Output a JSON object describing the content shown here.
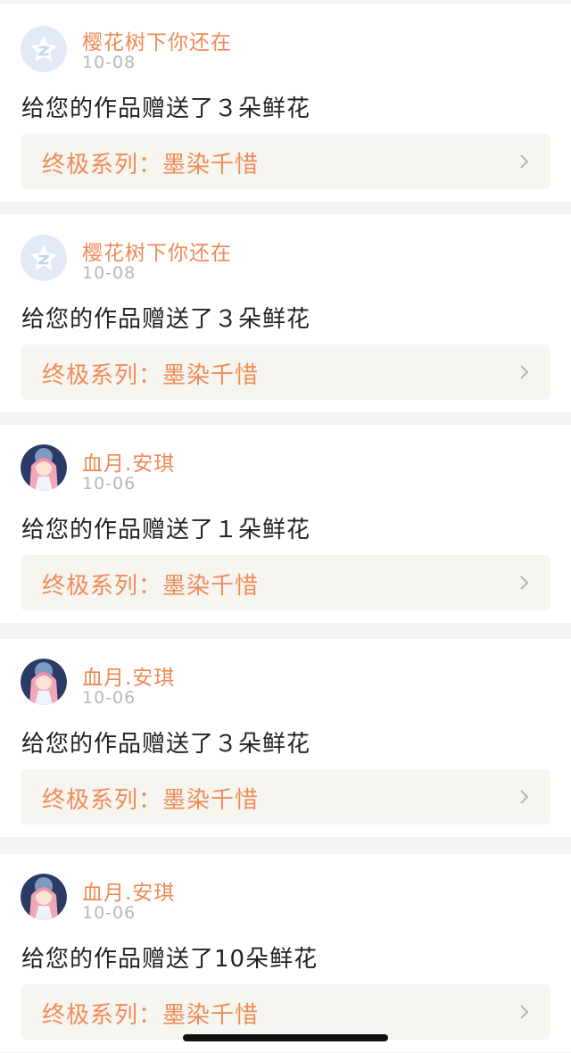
{
  "notifications": [
    {
      "user": "樱花树下你还在",
      "date": "10-08",
      "message": "给您的作品赠送了３朵鲜花",
      "work": "终极系列：墨染千惜",
      "avatar": "default-zone-avatar-icon"
    },
    {
      "user": "樱花树下你还在",
      "date": "10-08",
      "message": "给您的作品赠送了３朵鲜花",
      "work": "终极系列：墨染千惜",
      "avatar": "default-zone-avatar-icon"
    },
    {
      "user": "血月.安琪",
      "date": "10-06",
      "message": "给您的作品赠送了１朵鲜花",
      "work": "终极系列：墨染千惜",
      "avatar": "anime-girl-avatar"
    },
    {
      "user": "血月.安琪",
      "date": "10-06",
      "message": "给您的作品赠送了３朵鲜花",
      "work": "终极系列：墨染千惜",
      "avatar": "anime-girl-avatar"
    },
    {
      "user": "血月.安琪",
      "date": "10-06",
      "message": "给您的作品赠送了10朵鲜花",
      "work": "终极系列：墨染千惜",
      "avatar": "anime-girl-avatar"
    }
  ],
  "colors": {
    "username": "#ee8a55",
    "link_text": "#ef8c5a",
    "link_bg": "#f6f5ef",
    "date": "#b8b8b8",
    "page_bg": "#f3f3f3"
  }
}
